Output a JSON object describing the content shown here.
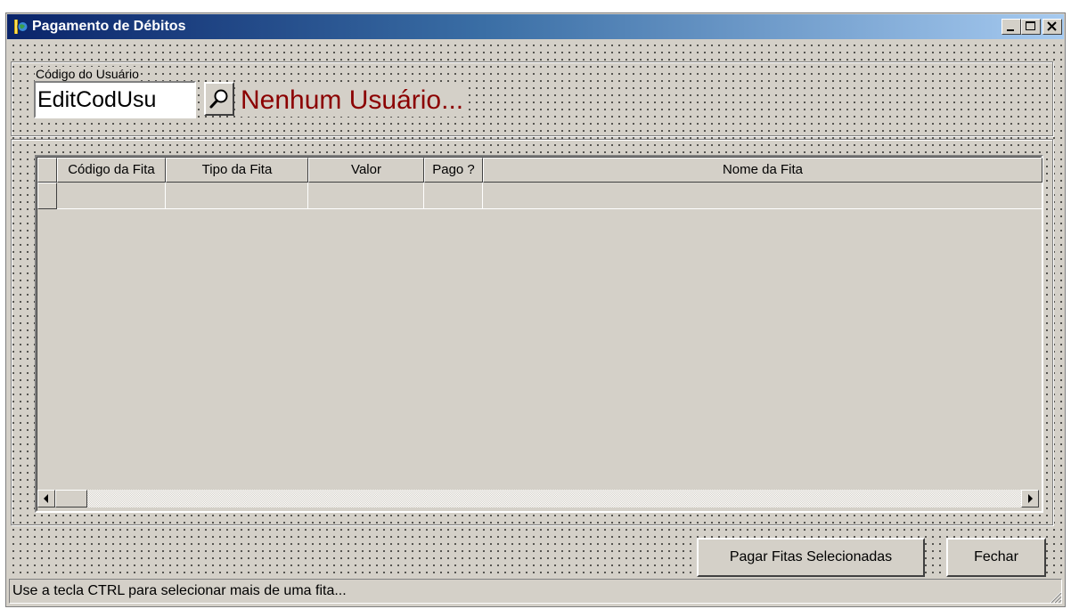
{
  "window": {
    "title": "Pagamento de Débitos"
  },
  "user_group": {
    "caption": "Código do Usuário",
    "edit_value": "EditCodUsu",
    "search_icon": "magnifier-icon",
    "user_label": "Nenhum Usuário...",
    "user_label_color": "#8b0000"
  },
  "grid": {
    "columns": [
      "Código da Fita",
      "Tipo da Fita",
      "Valor",
      "Pago ?",
      "Nome da Fita"
    ],
    "rows": []
  },
  "buttons": {
    "pay": "Pagar Fitas Selecionadas",
    "close": "Fechar"
  },
  "status": {
    "text": "Use a tecla CTRL para selecionar mais de uma fita..."
  },
  "colors": {
    "titlebar_start": "#0a246a",
    "titlebar_end": "#a6caf0",
    "face": "#d4d0c8"
  }
}
